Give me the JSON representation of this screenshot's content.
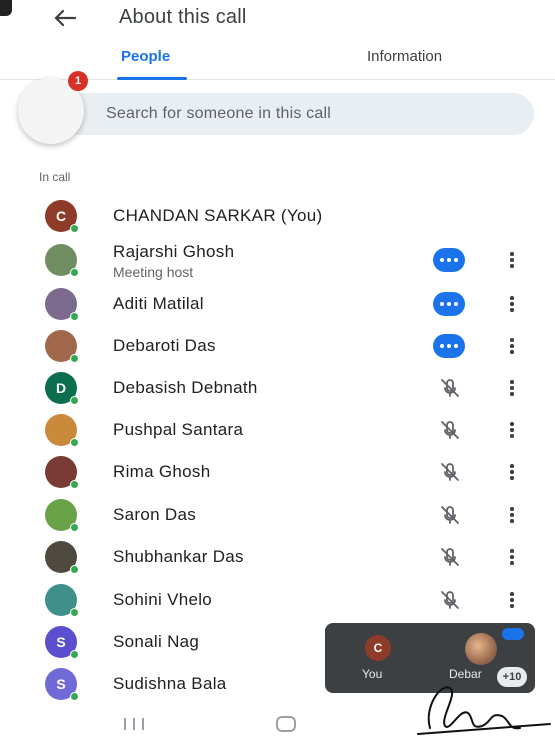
{
  "header": {
    "title": "About this call",
    "back_icon": "arrow-back-icon"
  },
  "tabs": [
    {
      "label": "People",
      "active": true
    },
    {
      "label": "Information",
      "active": false
    }
  ],
  "search": {
    "placeholder": "Search for someone in this call"
  },
  "chat_bubble": {
    "badge_count": "1"
  },
  "section_label": "In call",
  "participants": [
    {
      "name": "CHANDAN SARKAR (You)",
      "initial": "C",
      "avatar_color": "#8e3b2a",
      "subtitle": "",
      "audio": "none"
    },
    {
      "name": "Rajarshi Ghosh",
      "initial": "",
      "avatar_color": "#6f8f62",
      "subtitle": "Meeting host",
      "audio": "speaking"
    },
    {
      "name": "Aditi Matilal",
      "initial": "",
      "avatar_color": "#7d6a8f",
      "subtitle": "",
      "audio": "speaking"
    },
    {
      "name": "Debaroti Das",
      "initial": "",
      "avatar_color": "#a0674a",
      "subtitle": "",
      "audio": "speaking"
    },
    {
      "name": "Debasish Debnath",
      "initial": "D",
      "avatar_color": "#0b6e4f",
      "subtitle": "",
      "audio": "muted"
    },
    {
      "name": "Pushpal Santara",
      "initial": "",
      "avatar_color": "#c98a3b",
      "subtitle": "",
      "audio": "muted"
    },
    {
      "name": "Rima Ghosh",
      "initial": "",
      "avatar_color": "#7a3b35",
      "subtitle": "",
      "audio": "muted"
    },
    {
      "name": "Saron Das",
      "initial": "",
      "avatar_color": "#6aa24a",
      "subtitle": "",
      "audio": "muted"
    },
    {
      "name": "Shubhankar Das",
      "initial": "",
      "avatar_color": "#4f4a3f",
      "subtitle": "",
      "audio": "muted"
    },
    {
      "name": "Sohini Vhelo",
      "initial": "",
      "avatar_color": "#3f8f8a",
      "subtitle": "",
      "audio": "muted"
    },
    {
      "name": "Sonali Nag",
      "initial": "S",
      "avatar_color": "#5b4fcf",
      "subtitle": "",
      "audio": "none"
    },
    {
      "name": "Sudishna Bala",
      "initial": "S",
      "avatar_color": "#6f6ad6",
      "subtitle": "",
      "audio": "none"
    }
  ],
  "tiles": {
    "you_initial": "C",
    "you_label": "You",
    "other_label": "Debar",
    "more_count": "+10"
  },
  "colors": {
    "accent": "#1a73e8",
    "online": "#34a853",
    "badge": "#d93025"
  }
}
